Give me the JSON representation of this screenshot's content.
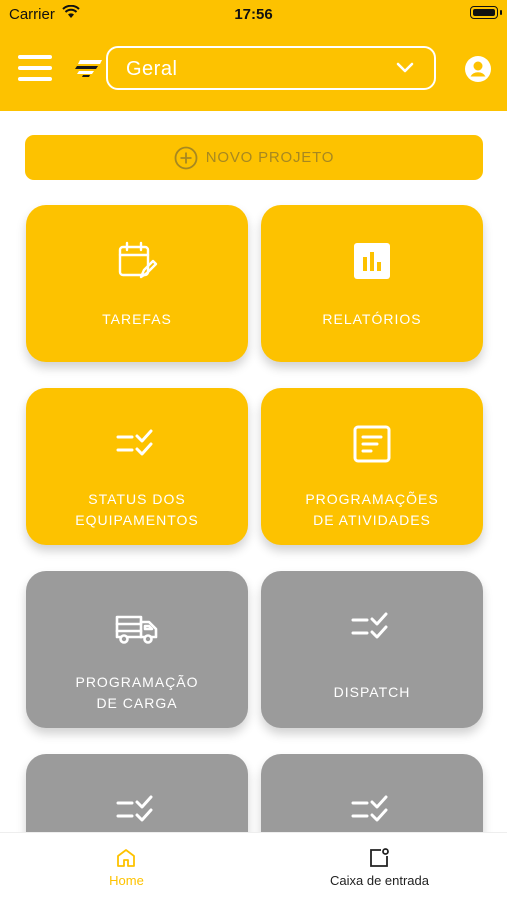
{
  "status_bar": {
    "carrier": "Carrier",
    "time": "17:56"
  },
  "header": {
    "project_selector": {
      "value": "Geral"
    }
  },
  "new_project": {
    "label": "NOVO PROJETO"
  },
  "tiles": [
    {
      "label": "TAREFAS",
      "icon": "calendar-edit-icon",
      "color": "#fdc200"
    },
    {
      "label": "RELATÓRIOS",
      "icon": "bar-chart-icon",
      "color": "#fdc200"
    },
    {
      "label": "STATUS DOS\nEQUIPAMENTOS",
      "icon": "checklist-icon",
      "color": "#fdc200"
    },
    {
      "label": "PROGRAMAÇÕES\nDE ATIVIDADES",
      "icon": "document-icon",
      "color": "#fdc200"
    },
    {
      "label": "PROGRAMAÇÃO\nDE CARGA",
      "icon": "truck-icon",
      "color": "#9b9b9b"
    },
    {
      "label": "DISPATCH",
      "icon": "checklist-icon",
      "color": "#9b9b9b"
    },
    {
      "label": "",
      "icon": "checklist-icon",
      "color": "#9b9b9b"
    },
    {
      "label": "",
      "icon": "checklist-icon",
      "color": "#9b9b9b"
    }
  ],
  "tabbar": [
    {
      "label": "Home",
      "icon": "home-icon",
      "active": true
    },
    {
      "label": "Caixa de entrada",
      "icon": "inbox-icon",
      "active": false
    }
  ],
  "colors": {
    "primary": "#fdc200",
    "disabled": "#9b9b9b",
    "new_project_text": "#a78820"
  }
}
